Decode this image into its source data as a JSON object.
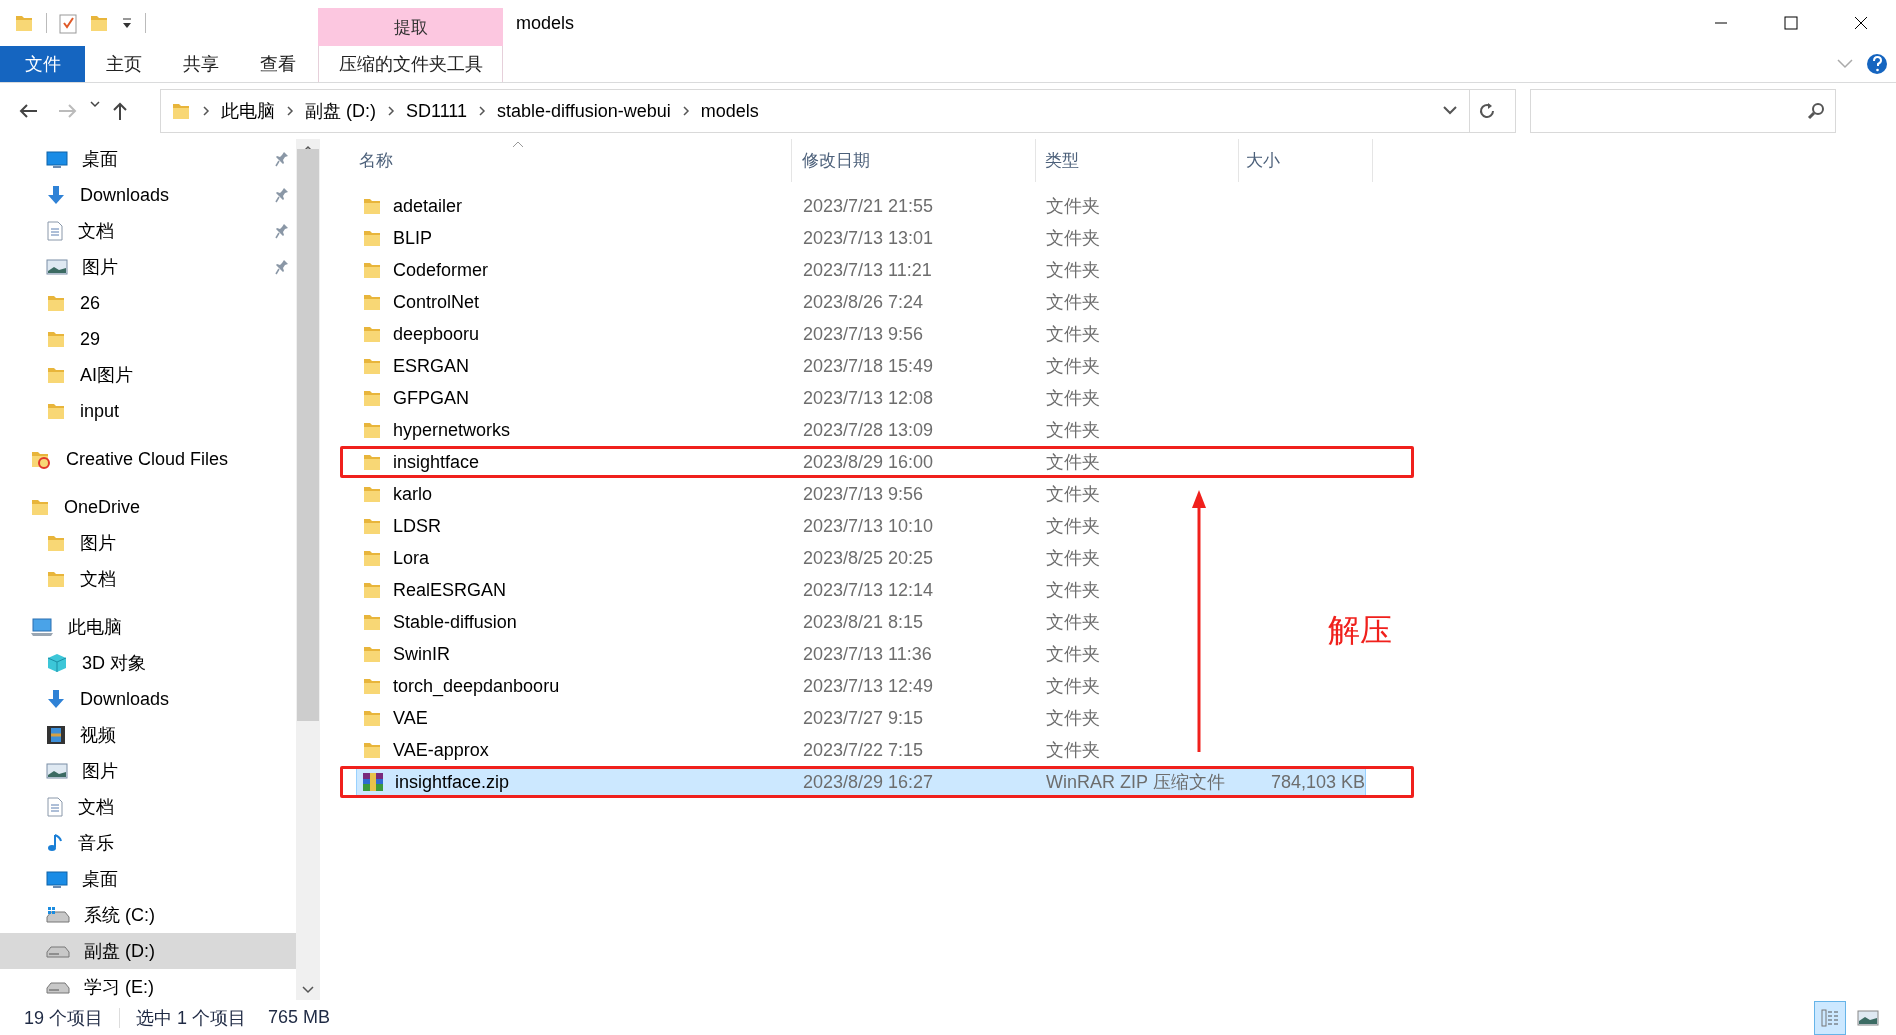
{
  "window": {
    "title": "models"
  },
  "ribbon": {
    "tabs": [
      {
        "label": "文件",
        "kind": "file"
      },
      {
        "label": "主页",
        "kind": "tab"
      },
      {
        "label": "共享",
        "kind": "tab"
      },
      {
        "label": "查看",
        "kind": "tab"
      },
      {
        "label": "压缩的文件夹工具",
        "kind": "contextual",
        "group": "提取"
      }
    ]
  },
  "address": {
    "breadcrumbs": [
      "此电脑",
      "副盘 (D:)",
      "SD1111",
      "stable-diffusion-webui",
      "models"
    ]
  },
  "navigation": {
    "quick_access": [
      {
        "label": "桌面",
        "kind": "desktop",
        "pinned": true
      },
      {
        "label": "Downloads",
        "kind": "download",
        "pinned": true
      },
      {
        "label": "文档",
        "kind": "document",
        "pinned": true
      },
      {
        "label": "图片",
        "kind": "picture",
        "pinned": true
      },
      {
        "label": "26",
        "kind": "folder",
        "pinned": false
      },
      {
        "label": "29",
        "kind": "folder",
        "pinned": false
      },
      {
        "label": "AI图片",
        "kind": "folder",
        "pinned": false
      },
      {
        "label": "input",
        "kind": "folder",
        "pinned": false
      }
    ],
    "roots": [
      {
        "label": "Creative Cloud Files",
        "kind": "cloud",
        "selected": false
      },
      {
        "label": "OneDrive",
        "kind": "folder",
        "selected": false,
        "children": [
          {
            "label": "图片",
            "kind": "folder",
            "selected": false
          },
          {
            "label": "文档",
            "kind": "folder",
            "selected": false
          }
        ]
      },
      {
        "label": "此电脑",
        "kind": "computer",
        "selected": false,
        "children": [
          {
            "label": "3D 对象",
            "kind": "cube",
            "selected": false
          },
          {
            "label": "Downloads",
            "kind": "download",
            "selected": false
          },
          {
            "label": "视频",
            "kind": "video",
            "selected": false
          },
          {
            "label": "图片",
            "kind": "picture",
            "selected": false
          },
          {
            "label": "文档",
            "kind": "document",
            "selected": false
          },
          {
            "label": "音乐",
            "kind": "music",
            "selected": false
          },
          {
            "label": "桌面",
            "kind": "desktop",
            "selected": false
          },
          {
            "label": "系统 (C:)",
            "kind": "system-drive",
            "selected": false
          },
          {
            "label": "副盘 (D:)",
            "kind": "drive",
            "selected": true
          },
          {
            "label": "学习 (E:)",
            "kind": "drive",
            "selected": false
          }
        ]
      }
    ]
  },
  "file_list": {
    "columns": [
      {
        "label": "名称",
        "sorted": true
      },
      {
        "label": "修改日期",
        "sorted": false
      },
      {
        "label": "类型",
        "sorted": false
      },
      {
        "label": "大小",
        "sorted": false
      }
    ],
    "rows": [
      {
        "name": "adetailer",
        "date": "2023/7/21 21:55",
        "type": "文件夹",
        "kind": "folder",
        "selected": false,
        "highlighted": false
      },
      {
        "name": "BLIP",
        "date": "2023/7/13 13:01",
        "type": "文件夹",
        "kind": "folder",
        "selected": false,
        "highlighted": false
      },
      {
        "name": "Codeformer",
        "date": "2023/7/13 11:21",
        "type": "文件夹",
        "kind": "folder",
        "selected": false,
        "highlighted": false
      },
      {
        "name": "ControlNet",
        "date": "2023/8/26 7:24",
        "type": "文件夹",
        "kind": "folder",
        "selected": false,
        "highlighted": false
      },
      {
        "name": "deepbooru",
        "date": "2023/7/13 9:56",
        "type": "文件夹",
        "kind": "folder",
        "selected": false,
        "highlighted": false
      },
      {
        "name": "ESRGAN",
        "date": "2023/7/18 15:49",
        "type": "文件夹",
        "kind": "folder",
        "selected": false,
        "highlighted": false
      },
      {
        "name": "GFPGAN",
        "date": "2023/7/13 12:08",
        "type": "文件夹",
        "kind": "folder",
        "selected": false,
        "highlighted": false
      },
      {
        "name": "hypernetworks",
        "date": "2023/7/28 13:09",
        "type": "文件夹",
        "kind": "folder",
        "selected": false,
        "highlighted": false
      },
      {
        "name": "insightface",
        "date": "2023/8/29 16:00",
        "type": "文件夹",
        "kind": "folder",
        "selected": false,
        "highlighted": true
      },
      {
        "name": "karlo",
        "date": "2023/7/13 9:56",
        "type": "文件夹",
        "kind": "folder",
        "selected": false,
        "highlighted": false
      },
      {
        "name": "LDSR",
        "date": "2023/7/13 10:10",
        "type": "文件夹",
        "kind": "folder",
        "selected": false,
        "highlighted": false
      },
      {
        "name": "Lora",
        "date": "2023/8/25 20:25",
        "type": "文件夹",
        "kind": "folder",
        "selected": false,
        "highlighted": false
      },
      {
        "name": "RealESRGAN",
        "date": "2023/7/13 12:14",
        "type": "文件夹",
        "kind": "folder",
        "selected": false,
        "highlighted": false
      },
      {
        "name": "Stable-diffusion",
        "date": "2023/8/21 8:15",
        "type": "文件夹",
        "kind": "folder",
        "selected": false,
        "highlighted": false
      },
      {
        "name": "SwinIR",
        "date": "2023/7/13 11:36",
        "type": "文件夹",
        "kind": "folder",
        "selected": false,
        "highlighted": false
      },
      {
        "name": "torch_deepdanbooru",
        "date": "2023/7/13 12:49",
        "type": "文件夹",
        "kind": "folder",
        "selected": false,
        "highlighted": false
      },
      {
        "name": "VAE",
        "date": "2023/7/27 9:15",
        "type": "文件夹",
        "kind": "folder",
        "selected": false,
        "highlighted": false
      },
      {
        "name": "VAE-approx",
        "date": "2023/7/22 7:15",
        "type": "文件夹",
        "kind": "folder",
        "selected": false,
        "highlighted": false
      },
      {
        "name": "insightface.zip",
        "date": "2023/8/29 16:27",
        "type": "WinRAR ZIP 压缩文件",
        "size": "784,103 KB",
        "kind": "archive",
        "selected": true,
        "highlighted": true
      }
    ],
    "annotation": {
      "label": "解压"
    }
  },
  "status_bar": {
    "item_count": "19 个项目",
    "selection": "选中 1 个项目",
    "selection_size": "765 MB"
  },
  "view_buttons": [
    {
      "kind": "details",
      "selected": true
    },
    {
      "kind": "large-icons",
      "selected": false
    }
  ]
}
